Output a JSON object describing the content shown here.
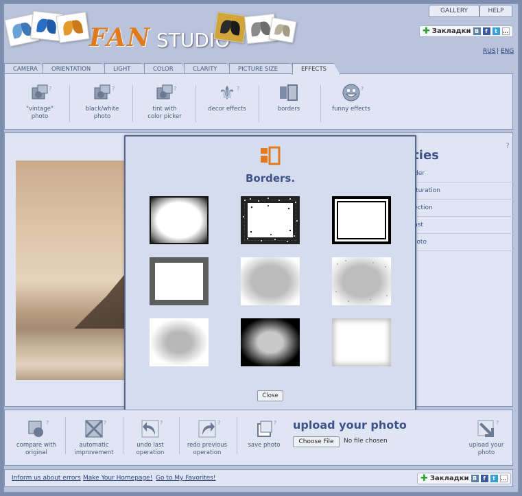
{
  "header": {
    "logo_fan": "FAN",
    "logo_studio": "STUDIO",
    "gallery": "GALLERY",
    "help": "HELP",
    "bookmarks": "Закладки",
    "lang_rus": "RUS",
    "lang_sep": "|",
    "lang_eng": "ENG"
  },
  "tabs": [
    {
      "label": "CAMERA"
    },
    {
      "label": "ORIENTATION"
    },
    {
      "label": "LIGHT"
    },
    {
      "label": "COLOR"
    },
    {
      "label": "CLARITY"
    },
    {
      "label": "PICTURE SIZE"
    },
    {
      "label": "EFFECTS"
    }
  ],
  "effects": [
    {
      "label1": "\"vintage\"",
      "label2": "photo"
    },
    {
      "label1": "black/white",
      "label2": "photo"
    },
    {
      "label1": "tint with",
      "label2": "color picker"
    },
    {
      "label1": "decor effects",
      "label2": ""
    },
    {
      "label1": "borders",
      "label2": ""
    },
    {
      "label1": "funny effects",
      "label2": ""
    }
  ],
  "help_mark": "?",
  "side_panel": {
    "title": "ities",
    "items": [
      "older",
      "saturation",
      "rrection",
      "trast",
      "photo"
    ]
  },
  "modal": {
    "title": "Borders.",
    "close": "Close"
  },
  "bottom_tools": [
    {
      "label1": "compare with",
      "label2": "original"
    },
    {
      "label1": "automatic",
      "label2": "improvement"
    },
    {
      "label1": "undo last",
      "label2": "operation"
    },
    {
      "label1": "redo previous",
      "label2": "operation"
    },
    {
      "label1": "save photo",
      "label2": ""
    }
  ],
  "upload": {
    "title": "upload your photo",
    "choose": "Choose File",
    "no_file": "No file chosen",
    "tool_label1": "upload your",
    "tool_label2": "photo"
  },
  "footer": {
    "link1": "Inform us about errors",
    "link2": "Make Your Homepage!",
    "link3": "Go to My Favorites!"
  },
  "colors": {
    "accent_orange": "#e07a1c",
    "title_blue": "#3e5288",
    "panel": "#dfe5f3",
    "frame": "#b9c3dc"
  }
}
